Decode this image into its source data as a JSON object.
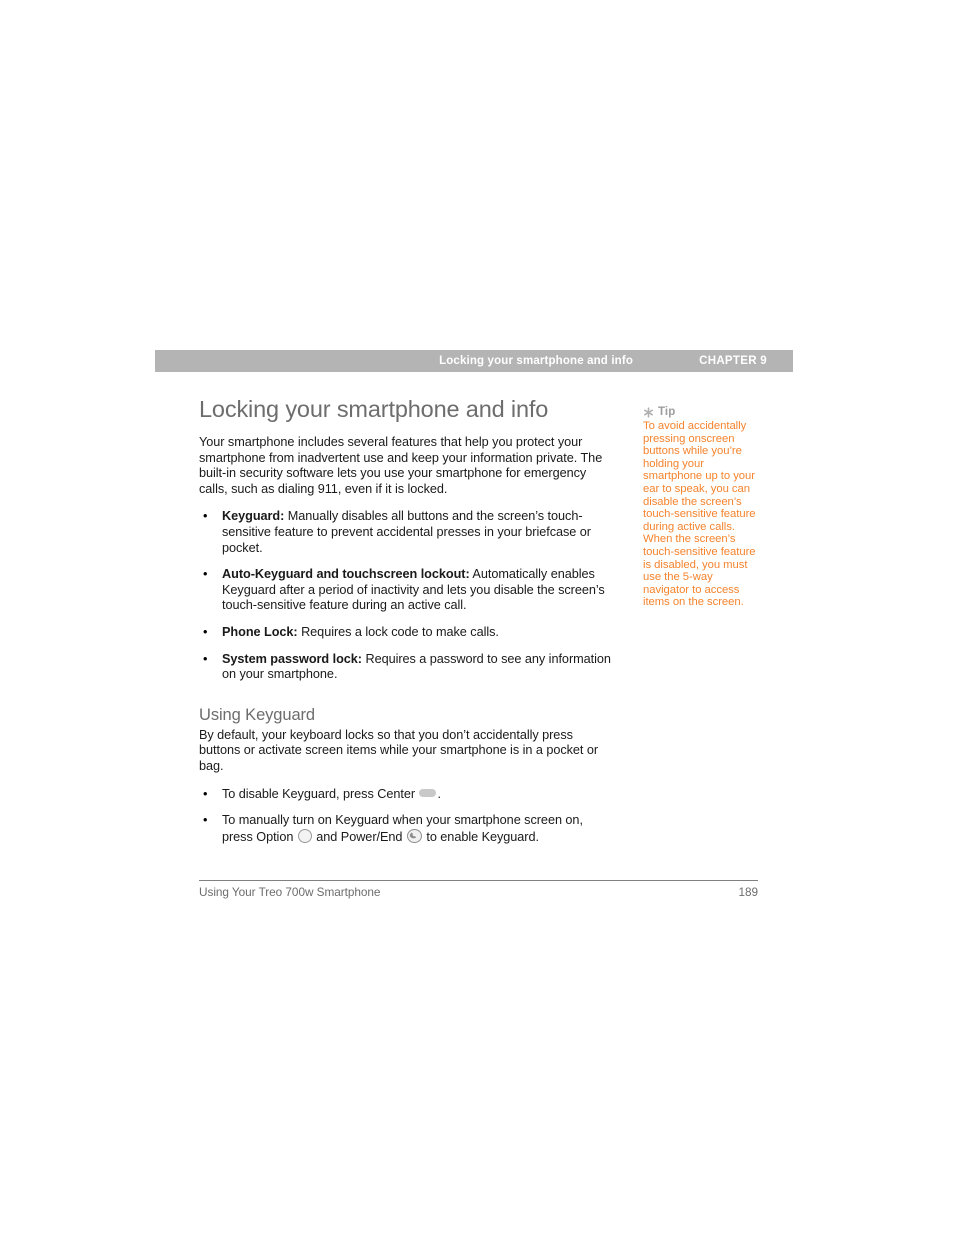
{
  "header": {
    "running_title": "Locking your smartphone and info",
    "chapter": "CHAPTER 9",
    "bar_color": "#b4b4b4",
    "text_color": "#ffffff"
  },
  "main": {
    "title": "Locking your smartphone and info",
    "title_color": "#6d6d6d",
    "intro": "Your smartphone includes several features that help you protect your smartphone from inadvertent use and keep your information private. The built-in security software lets you use your smartphone for emergency calls, such as dialing 911, even if it is locked.",
    "feature_bullets": [
      {
        "lead": "Keyguard:",
        "text": " Manually disables all buttons and the screen’s touch-sensitive feature to prevent accidental presses in your briefcase or pocket."
      },
      {
        "lead": "Auto-Keyguard and touchscreen lockout:",
        "text": " Automatically enables Keyguard after a period of inactivity and lets you disable the screen’s touch-sensitive feature during an active call."
      },
      {
        "lead": "Phone Lock:",
        "text": " Requires a lock code to make calls."
      },
      {
        "lead": "System password lock:",
        "text": " Requires a password to see any information on your smartphone."
      }
    ],
    "subhead": "Using Keyguard",
    "subhead_intro": "By default, your keyboard locks so that you don’t accidentally press buttons or activate screen items while your smartphone is in a pocket or bag.",
    "keyguard_bullets": [
      {
        "part1": "To disable Keyguard, press Center ",
        "icon1": "center-key-icon",
        "part2": ".",
        "icon2": null,
        "part3": ""
      },
      {
        "part1": "To manually turn on Keyguard when your smartphone screen on, press Option ",
        "icon1": "option-key-icon",
        "part2": " and Power/End ",
        "icon2": "power-end-key-icon",
        "part3": " to enable Keyguard."
      }
    ]
  },
  "tip": {
    "icon": "asterisk-icon",
    "label": "Tip",
    "label_color": "#9d9d9d",
    "body": "To avoid accidentally pressing onscreen buttons while you’re holding your smartphone up to your ear to speak, you can disable the screen’s touch-sensitive feature during active calls. When the screen’s touch-sensitive feature is disabled, you must use the 5-way navigator to access items on the screen.",
    "body_color": "#f5842e"
  },
  "footer": {
    "left": "Using Your Treo 700w Smartphone",
    "page_number": "189",
    "color": "#6d6d6d"
  }
}
